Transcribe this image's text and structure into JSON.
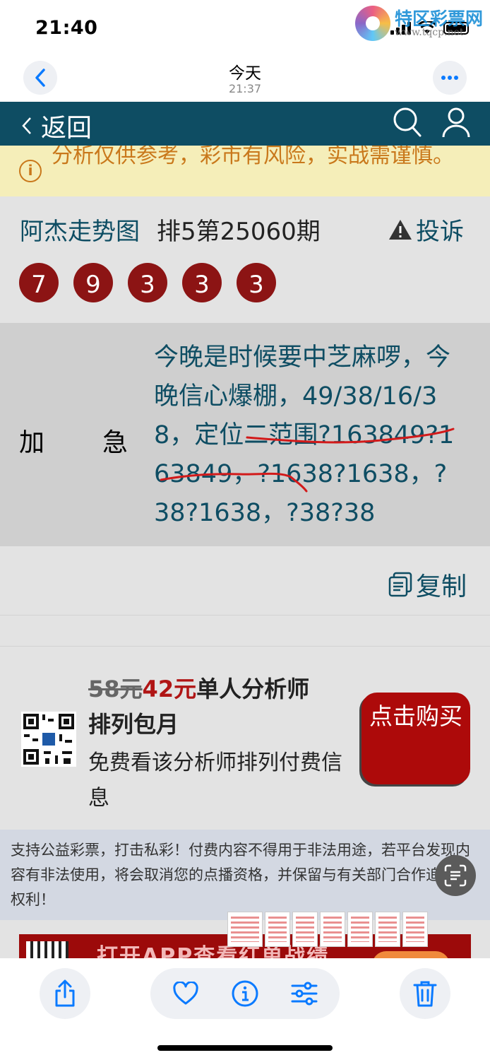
{
  "status_bar": {
    "time": "21:40",
    "watermark_title": "特区彩票网",
    "watermark_url": "www.tqcp.net"
  },
  "photo_header": {
    "title": "今天",
    "subtitle": "21:37"
  },
  "page": {
    "nav": {
      "back_label": "返回"
    },
    "notice": {
      "text": "分析仅供参考，彩市有风险，实战需谨慎。"
    },
    "title": {
      "author_link": "阿杰走势图",
      "issue": "排5第25060期",
      "complain": "投诉"
    },
    "balls": [
      "7",
      "9",
      "3",
      "3",
      "3"
    ],
    "post": {
      "label_1": "加",
      "label_2": "急",
      "content": "今晚是时候要中芝麻啰，今晚信心爆棚，49/38/16/38，定位二范围?163849?163849，?1638?1638，?38?1638，?38?38"
    },
    "copy_label": "复制",
    "promo": {
      "old_price": "58元",
      "new_price": "42元",
      "title_rest": "单人分析师",
      "title_line2": "排列包月",
      "description": "免费看该分析师排列付费信息",
      "buy_button": "点击购买"
    },
    "disclaimer": "支持公益彩票，打击私彩！付费内容不得用于非法用途，若平台发现内容有非法使用，将会取消您的点播资格，并保留与有关部门合作追究的权利！",
    "app_banner": {
      "text": "打开APP查看红单战绩"
    }
  },
  "colors": {
    "nav_bg": "#0e4d63",
    "notice_bg": "#f5eeb9",
    "notice_text": "#c9781b",
    "ball": "#8c1414",
    "post_text": "#0e4d63",
    "buy_button": "#ad0a0a",
    "ios_blue": "#0a7aff"
  },
  "icons": {
    "header": [
      "chevron-left-icon",
      "ellipsis-icon"
    ],
    "nav": [
      "chevron-left-icon",
      "search-icon",
      "user-icon"
    ],
    "toolbar": [
      "share-icon",
      "heart-icon",
      "info-icon",
      "sliders-icon",
      "trash-icon"
    ]
  }
}
